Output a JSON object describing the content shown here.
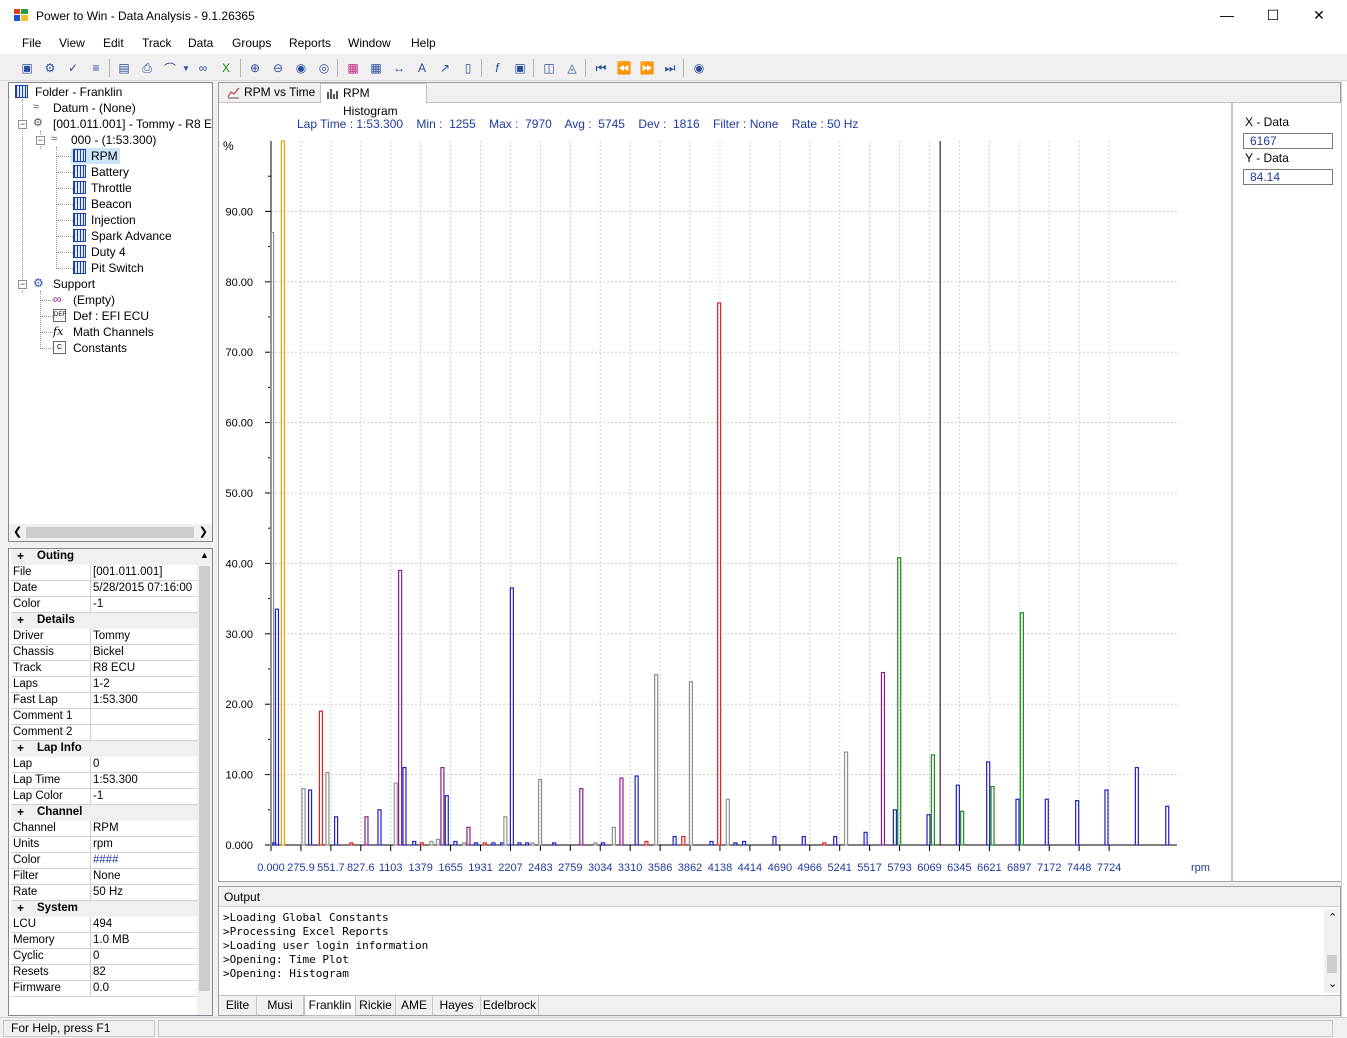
{
  "window": {
    "title": "Power to Win - Data Analysis - 9.1.26365"
  },
  "menu": [
    "File",
    "View",
    "Edit",
    "Track",
    "Data",
    "Groups",
    "Reports",
    "Window",
    "Help"
  ],
  "tree": {
    "folder": "Folder - Franklin",
    "datum": "Datum - (None)",
    "session": "[001.011.001] - Tommy - R8 ECU",
    "lap": "000 - (1:53.300)",
    "channels": [
      "RPM",
      "Battery",
      "Throttle",
      "Beacon",
      "Injection",
      "Spark Advance",
      "Duty 4",
      "Pit Switch"
    ],
    "support": "Support",
    "support_items": [
      "(Empty)",
      "Def : EFI ECU",
      "Math Channels",
      "Constants"
    ]
  },
  "properties": [
    {
      "cat": "Outing"
    },
    {
      "k": "File",
      "v": "[001.011.001]"
    },
    {
      "k": "Date",
      "v": "5/28/2015  07:16:00"
    },
    {
      "k": "Color",
      "v": "-1"
    },
    {
      "cat": "Details"
    },
    {
      "k": "Driver",
      "v": "Tommy"
    },
    {
      "k": "Chassis",
      "v": "Bickel"
    },
    {
      "k": "Track",
      "v": "R8 ECU"
    },
    {
      "k": "Laps",
      "v": "1-2"
    },
    {
      "k": "Fast Lap",
      "v": "1:53.300"
    },
    {
      "k": "Comment 1",
      "v": ""
    },
    {
      "k": "Comment 2",
      "v": ""
    },
    {
      "cat": "Lap Info"
    },
    {
      "k": "Lap",
      "v": "0"
    },
    {
      "k": "Lap Time",
      "v": "1:53.300"
    },
    {
      "k": "Lap Color",
      "v": "-1"
    },
    {
      "cat": "Channel"
    },
    {
      "k": "Channel",
      "v": "RPM"
    },
    {
      "k": "Units",
      "v": "rpm"
    },
    {
      "k": "Color",
      "v": "####",
      "color": "#1f3aa0"
    },
    {
      "k": "Filter",
      "v": "None"
    },
    {
      "k": "Rate",
      "v": "50 Hz"
    },
    {
      "cat": "System"
    },
    {
      "k": "LCU",
      "v": "494"
    },
    {
      "k": "Memory",
      "v": "1.0 MB"
    },
    {
      "k": "Cyclic",
      "v": "0"
    },
    {
      "k": "Resets",
      "v": "82"
    },
    {
      "k": "Firmware",
      "v": "0.0"
    }
  ],
  "tabs": [
    "RPM vs Time",
    "RPM Histogram"
  ],
  "active_tab": 1,
  "side": {
    "x_label": "X - Data",
    "x_value": "6167",
    "y_label": "Y - Data",
    "y_value": "84.14"
  },
  "chart_data": {
    "type": "bar",
    "info": "Lap Time : 1:53.300    Min :  1255    Max :  7970    Avg :  5745    Dev :  1816    Filter : None    Rate : 50 Hz",
    "ylabel": "%",
    "xlabel": "rpm",
    "ylim": [
      0,
      100
    ],
    "yticks": [
      "0.000",
      "10.00",
      "20.00",
      "30.00",
      "40.00",
      "50.00",
      "60.00",
      "70.00",
      "80.00",
      "90.00"
    ],
    "xticks": [
      "0.000",
      "275.9",
      "551.7",
      "827.6",
      "1103",
      "1379",
      "1655",
      "1931",
      "2207",
      "2483",
      "2759",
      "3034",
      "3310",
      "3586",
      "3862",
      "4138",
      "4414",
      "4690",
      "4966",
      "5241",
      "5517",
      "5793",
      "6069",
      "6345",
      "6621",
      "6897",
      "7172",
      "7448",
      "7724"
    ],
    "cursor_x": 6167,
    "colors": {
      "blue": "#1f1fbf",
      "orange": "#f0a000",
      "grey": "#909090",
      "red": "#e02020",
      "purple": "#8a1c8a",
      "green": "#1a8a1a"
    },
    "bars": [
      {
        "x": 10,
        "v": 87,
        "c": "grey"
      },
      {
        "x": 30,
        "v": 0.3,
        "c": "blue"
      },
      {
        "x": 55,
        "v": 33.5,
        "c": "blue"
      },
      {
        "x": 110,
        "v": 100,
        "c": "orange"
      },
      {
        "x": 300,
        "v": 8,
        "c": "grey"
      },
      {
        "x": 360,
        "v": 7.8,
        "c": "blue"
      },
      {
        "x": 460,
        "v": 19,
        "c": "red"
      },
      {
        "x": 520,
        "v": 10.3,
        "c": "grey"
      },
      {
        "x": 600,
        "v": 4,
        "c": "blue"
      },
      {
        "x": 740,
        "v": 0.3,
        "c": "red"
      },
      {
        "x": 880,
        "v": 4,
        "c": "purple"
      },
      {
        "x": 1000,
        "v": 5,
        "c": "blue"
      },
      {
        "x": 1150,
        "v": 8.8,
        "c": "grey"
      },
      {
        "x": 1190,
        "v": 39,
        "c": "purple"
      },
      {
        "x": 1230,
        "v": 11,
        "c": "blue"
      },
      {
        "x": 1320,
        "v": 0.5,
        "c": "blue"
      },
      {
        "x": 1390,
        "v": 0.3,
        "c": "red"
      },
      {
        "x": 1480,
        "v": 0.5,
        "c": "grey"
      },
      {
        "x": 1540,
        "v": 0.8,
        "c": "grey"
      },
      {
        "x": 1580,
        "v": 11,
        "c": "purple"
      },
      {
        "x": 1620,
        "v": 7,
        "c": "blue"
      },
      {
        "x": 1700,
        "v": 0.5,
        "c": "blue"
      },
      {
        "x": 1780,
        "v": 0.3,
        "c": "grey"
      },
      {
        "x": 1820,
        "v": 2.5,
        "c": "purple"
      },
      {
        "x": 1890,
        "v": 0.3,
        "c": "blue"
      },
      {
        "x": 1970,
        "v": 0.3,
        "c": "red"
      },
      {
        "x": 2050,
        "v": 0.3,
        "c": "blue"
      },
      {
        "x": 2130,
        "v": 0.3,
        "c": "blue"
      },
      {
        "x": 2160,
        "v": 4,
        "c": "grey"
      },
      {
        "x": 2220,
        "v": 36.5,
        "c": "blue"
      },
      {
        "x": 2290,
        "v": 0.3,
        "c": "blue"
      },
      {
        "x": 2360,
        "v": 0.3,
        "c": "blue"
      },
      {
        "x": 2410,
        "v": 0.3,
        "c": "grey"
      },
      {
        "x": 2480,
        "v": 9.3,
        "c": "grey"
      },
      {
        "x": 2610,
        "v": 0.3,
        "c": "blue"
      },
      {
        "x": 2860,
        "v": 8,
        "c": "purple"
      },
      {
        "x": 2990,
        "v": 0.3,
        "c": "grey"
      },
      {
        "x": 3060,
        "v": 0.3,
        "c": "blue"
      },
      {
        "x": 3160,
        "v": 2.5,
        "c": "grey"
      },
      {
        "x": 3230,
        "v": 9.5,
        "c": "purple"
      },
      {
        "x": 3370,
        "v": 9.8,
        "c": "blue"
      },
      {
        "x": 3460,
        "v": 0.5,
        "c": "red"
      },
      {
        "x": 3550,
        "v": 24.2,
        "c": "grey"
      },
      {
        "x": 3720,
        "v": 1.2,
        "c": "blue"
      },
      {
        "x": 3800,
        "v": 1.2,
        "c": "red"
      },
      {
        "x": 3870,
        "v": 23.2,
        "c": "grey"
      },
      {
        "x": 4060,
        "v": 0.5,
        "c": "blue"
      },
      {
        "x": 4130,
        "v": 77,
        "c": "red"
      },
      {
        "x": 4210,
        "v": 6.5,
        "c": "grey"
      },
      {
        "x": 4280,
        "v": 0.3,
        "c": "blue"
      },
      {
        "x": 4360,
        "v": 0.5,
        "c": "blue"
      },
      {
        "x": 4640,
        "v": 1.2,
        "c": "blue"
      },
      {
        "x": 4910,
        "v": 1.2,
        "c": "blue"
      },
      {
        "x": 5100,
        "v": 0.3,
        "c": "red"
      },
      {
        "x": 5200,
        "v": 1.2,
        "c": "blue"
      },
      {
        "x": 5300,
        "v": 13.2,
        "c": "grey"
      },
      {
        "x": 5480,
        "v": 1.8,
        "c": "blue"
      },
      {
        "x": 5640,
        "v": 24.5,
        "c": "purple"
      },
      {
        "x": 5750,
        "v": 5,
        "c": "blue"
      },
      {
        "x": 5790,
        "v": 40.8,
        "c": "green"
      },
      {
        "x": 6060,
        "v": 4.3,
        "c": "blue"
      },
      {
        "x": 6100,
        "v": 12.8,
        "c": "green"
      },
      {
        "x": 6330,
        "v": 8.5,
        "c": "blue"
      },
      {
        "x": 6370,
        "v": 4.8,
        "c": "green"
      },
      {
        "x": 6610,
        "v": 11.8,
        "c": "blue"
      },
      {
        "x": 6650,
        "v": 8.3,
        "c": "green"
      },
      {
        "x": 6880,
        "v": 6.5,
        "c": "blue"
      },
      {
        "x": 6920,
        "v": 33,
        "c": "green"
      },
      {
        "x": 7150,
        "v": 6.5,
        "c": "blue"
      },
      {
        "x": 7430,
        "v": 6.3,
        "c": "blue"
      },
      {
        "x": 7700,
        "v": 7.8,
        "c": "blue"
      },
      {
        "x": 7980,
        "v": 11,
        "c": "blue"
      },
      {
        "x": 8260,
        "v": 5.5,
        "c": "blue"
      }
    ]
  },
  "output": {
    "title": "Output",
    "lines": [
      ">Loading Global Constants",
      ">Processing Excel Reports",
      ">Loading user login information",
      ">Opening: Time Plot",
      ">Opening: Histogram"
    ],
    "tabs": [
      "Elite",
      "Musi",
      "Franklin",
      "Rickie",
      "AME",
      "Hayes",
      "Edelbrock"
    ],
    "active_tab": 2
  },
  "status": {
    "help": "For Help, press F1"
  }
}
